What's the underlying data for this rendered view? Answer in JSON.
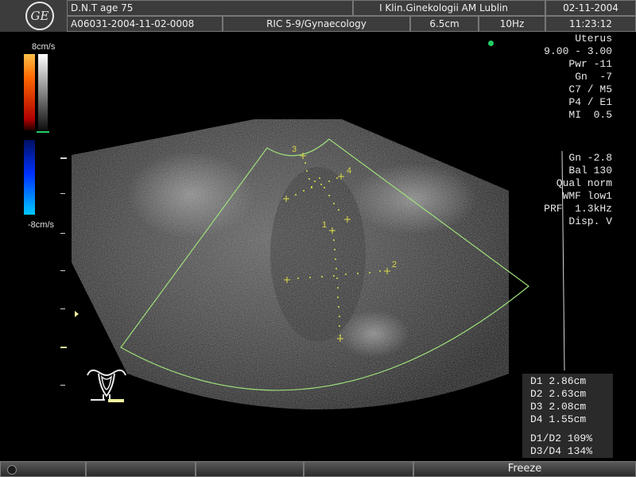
{
  "header": {
    "patient": "D.N.T age 75",
    "institution": "I Klin.Ginekologii AM Lublin",
    "date": "02-11-2004",
    "exam_id": "A06031-2004-11-02-0008",
    "probe": "RIC 5-9/Gynaecology",
    "depth": "6.5cm",
    "frame_rate": "10Hz",
    "time": "11:23:12",
    "logo_text": "GE"
  },
  "color_scale": {
    "top_label": "8cm/s",
    "bottom_label": "-8cm/s"
  },
  "params_top": [
    "Uterus",
    "9.00 - 3.00",
    "Pwr -11",
    "Gn  -7",
    "C7 / M5",
    "P4 / E1",
    "MI  0.5"
  ],
  "params_doppler": [
    "Gn -2.8",
    "Bal 130",
    "Qual norm",
    "WMF low1",
    "PRF  1.3kHz",
    "Disp. V"
  ],
  "calipers": [
    "1",
    "2",
    "3",
    "4"
  ],
  "measurements": {
    "d1": "D1 2.86cm",
    "d2": "D2 2.63cm",
    "d3": "D3 2.08cm",
    "d4": "D4 1.55cm",
    "r1": "D1/D2 109%",
    "r2": "D3/D4 134%"
  },
  "footer": {
    "freeze_label": "Freeze"
  },
  "colors": {
    "sector_outline": "#9ee07a",
    "caliper": "#e0e04a",
    "indicator_dot": "#22cc66"
  }
}
